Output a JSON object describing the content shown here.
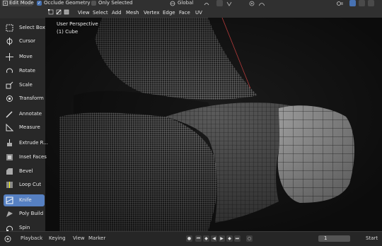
{
  "header": {
    "mode_label": "Edit Mode",
    "occlude_label": "Occlude Geometry",
    "occlude_checked": true,
    "only_selected_label": "Only Selected",
    "only_selected_checked": false,
    "orientation_label": "Global"
  },
  "menu": {
    "items": [
      "View",
      "Select",
      "Add",
      "Mesh",
      "Vertex",
      "Edge",
      "Face",
      "UV"
    ]
  },
  "viewport": {
    "perspective_label": "User Perspective",
    "object_label": "(1) Cube"
  },
  "toolbar": {
    "tools": [
      {
        "label": "Select Box",
        "icon": "select-box-icon",
        "active": false
      },
      {
        "label": "Cursor",
        "icon": "cursor-icon",
        "active": false
      },
      {
        "label": "Move",
        "icon": "move-icon",
        "active": false
      },
      {
        "label": "Rotate",
        "icon": "rotate-icon",
        "active": false
      },
      {
        "label": "Scale",
        "icon": "scale-icon",
        "active": false
      },
      {
        "label": "Transform",
        "icon": "transform-icon",
        "active": false
      },
      {
        "label": "Annotate",
        "icon": "annotate-icon",
        "active": false
      },
      {
        "label": "Measure",
        "icon": "measure-icon",
        "active": false
      },
      {
        "label": "Extrude R...",
        "icon": "extrude-icon",
        "active": false
      },
      {
        "label": "Inset Faces",
        "icon": "inset-icon",
        "active": false
      },
      {
        "label": "Bevel",
        "icon": "bevel-icon",
        "active": false
      },
      {
        "label": "Loop Cut",
        "icon": "loop-cut-icon",
        "active": false
      },
      {
        "label": "Knife",
        "icon": "knife-icon",
        "active": true
      },
      {
        "label": "Poly Build",
        "icon": "poly-build-icon",
        "active": false
      },
      {
        "label": "Spin",
        "icon": "spin-icon",
        "active": false
      }
    ]
  },
  "timeline": {
    "playback_label": "Playback",
    "keying_label": "Keying",
    "view_label": "View",
    "marker_label": "Marker",
    "current_frame": "1",
    "start_label": "Start"
  },
  "colors": {
    "accent": "#5680c2",
    "panel": "#303030",
    "viewport_bg": "#1e1e1e"
  }
}
